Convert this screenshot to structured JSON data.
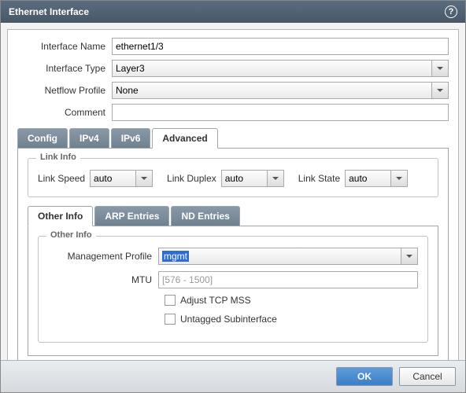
{
  "title": "Ethernet Interface",
  "form": {
    "interface_name_label": "Interface Name",
    "interface_name": "ethernet1/3",
    "interface_type_label": "Interface Type",
    "interface_type": "Layer3",
    "netflow_label": "Netflow Profile",
    "netflow": "None",
    "comment_label": "Comment",
    "comment": ""
  },
  "tabs": {
    "config": "Config",
    "ipv4": "IPv4",
    "ipv6": "IPv6",
    "advanced": "Advanced"
  },
  "link_info": {
    "legend": "Link Info",
    "speed_label": "Link Speed",
    "speed": "auto",
    "duplex_label": "Link Duplex",
    "duplex": "auto",
    "state_label": "Link State",
    "state": "auto"
  },
  "subtabs": {
    "other": "Other Info",
    "arp": "ARP Entries",
    "nd": "ND Entries"
  },
  "other_info": {
    "legend": "Other Info",
    "mgmt_label": "Management Profile",
    "mgmt_value": "mgmt",
    "mtu_label": "MTU",
    "mtu_placeholder": "[576 - 1500]",
    "adjust_mss": "Adjust TCP MSS",
    "untagged": "Untagged Subinterface"
  },
  "buttons": {
    "ok": "OK",
    "cancel": "Cancel"
  }
}
